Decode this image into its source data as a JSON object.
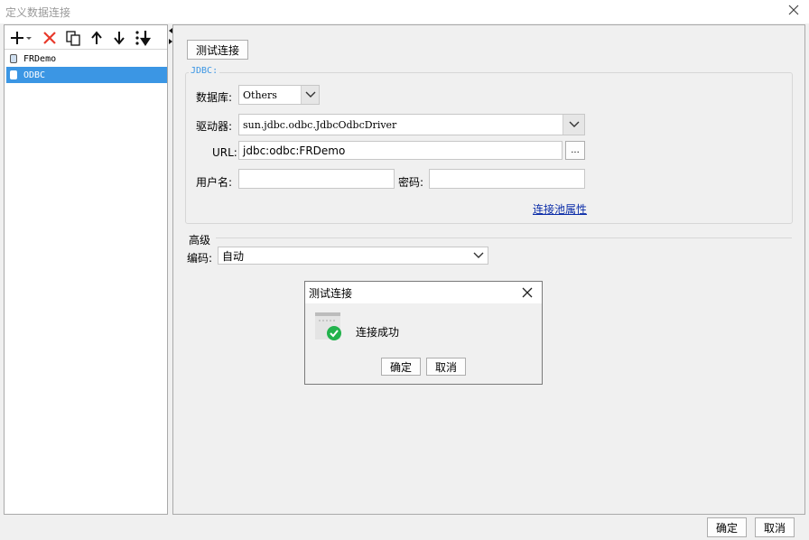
{
  "window": {
    "title": "定义数据连接"
  },
  "toolbar": {
    "add_icon": "plus-icon",
    "delete_icon": "delete-x-icon",
    "copy_icon": "copy-icon",
    "up_icon": "arrow-up-icon",
    "down_icon": "arrow-down-icon",
    "sort_icon": "sort-icon"
  },
  "connections": [
    {
      "name": "FRDemo",
      "selected": false
    },
    {
      "name": "ODBC",
      "selected": true
    }
  ],
  "form": {
    "test_button": "测试连接",
    "group_title": "JDBC:",
    "database_label": "数据库:",
    "database_value": "Others",
    "driver_label": "驱动器:",
    "driver_value": "sun.jdbc.odbc.JdbcOdbcDriver",
    "url_label": "URL:",
    "url_value": "jdbc:odbc:FRDemo",
    "browse_button": "...",
    "username_label": "用户名:",
    "username_value": "",
    "password_label": "密码:",
    "password_value": "",
    "pool_link": "连接池属性",
    "advanced_title": "高级",
    "encoding_label": "编码:",
    "encoding_value": "自动"
  },
  "dialog": {
    "title": "测试连接",
    "message": "连接成功",
    "ok": "确定",
    "cancel": "取消",
    "status_icon": "success-check-icon",
    "accent": "#22b24c"
  },
  "footer": {
    "ok": "确定",
    "cancel": "取消"
  },
  "colors": {
    "selection": "#3b96e4",
    "link": "#0a2ca8",
    "delete": "#e8392b"
  }
}
